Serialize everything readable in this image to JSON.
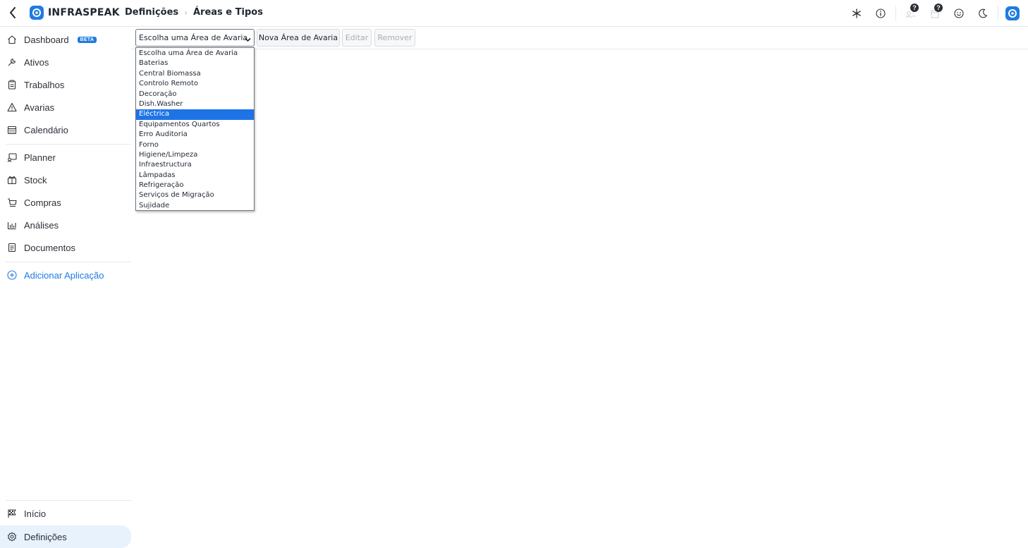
{
  "header": {
    "logo_text": "INFRASPEAK",
    "breadcrumb": [
      "Definições",
      "Áreas e Tipos"
    ],
    "brand_color": "#1f7be0",
    "icons": [
      "asterisk-icon",
      "info-icon",
      "user-help-icon",
      "calendar-help-icon",
      "smile-icon",
      "moon-icon",
      "app-logo-icon"
    ],
    "badge_text": "?"
  },
  "sidebar": {
    "items": [
      {
        "label": "Dashboard",
        "icon": "home-icon",
        "badge": "BETA"
      },
      {
        "label": "Ativos",
        "icon": "wrench-icon"
      },
      {
        "label": "Trabalhos",
        "icon": "clipboard-icon"
      },
      {
        "label": "Avarias",
        "icon": "warning-icon"
      },
      {
        "label": "Calendário",
        "icon": "calendar-icon"
      },
      {
        "label": "Planner",
        "icon": "planner-icon"
      },
      {
        "label": "Stock",
        "icon": "box-icon"
      },
      {
        "label": "Compras",
        "icon": "cart-icon"
      },
      {
        "label": "Análises",
        "icon": "chart-icon"
      },
      {
        "label": "Documentos",
        "icon": "document-icon"
      }
    ],
    "add_app_label": "Adicionar Aplicação",
    "bottom": [
      {
        "label": "Início",
        "icon": "flag-icon"
      },
      {
        "label": "Definições",
        "icon": "gear-icon",
        "active": true
      }
    ]
  },
  "toolbar": {
    "select_value": "Escolha uma Área de Avaria",
    "new_label": "Nova Área de Avaria",
    "edit_label": "Editar",
    "remove_label": "Remover"
  },
  "dropdown": {
    "selected_index": 6,
    "options": [
      "Escolha uma Área de Avaria",
      "Baterias",
      "Central Biomassa",
      "Controlo Remoto",
      "Decoração",
      "Dish.Washer",
      "Eléctrica",
      "Equipamentos Quartos",
      "Erro Auditoria",
      "Forno",
      "Higiene/Limpeza",
      "Infraestructura",
      "Lâmpadas",
      "Refrigeração",
      "Serviços de Migração",
      "Sujidade"
    ],
    "highlight_color": "#1e74e6"
  }
}
